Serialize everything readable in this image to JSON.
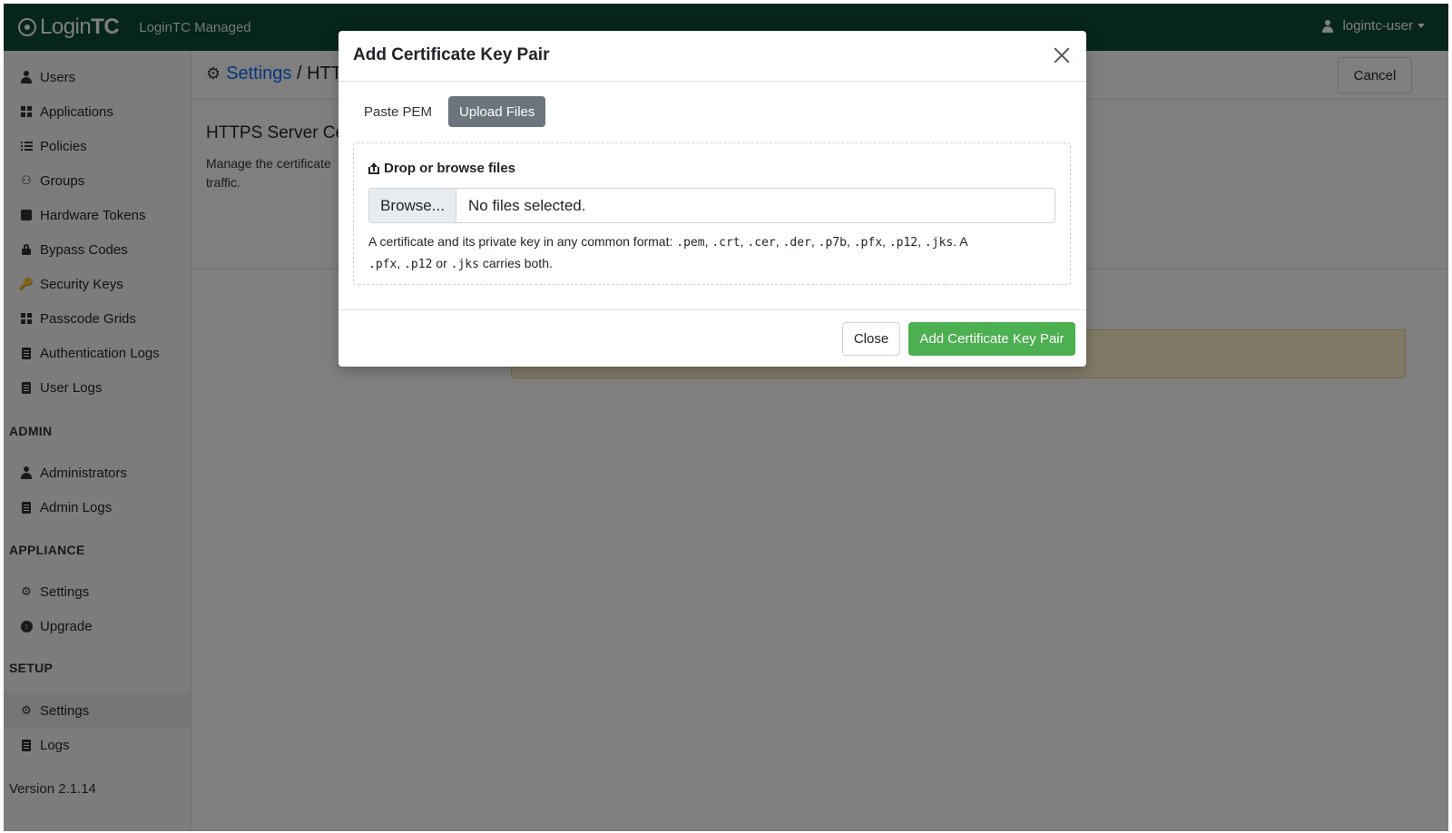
{
  "navbar": {
    "brand_login": "Login",
    "brand_tc": "TC",
    "product_name": "LoginTC Managed",
    "username": "logintc-user"
  },
  "sidebar": {
    "items": [
      {
        "label": "Users",
        "icon": "user-icon"
      },
      {
        "label": "Applications",
        "icon": "grid-icon"
      },
      {
        "label": "Policies",
        "icon": "list-icon"
      },
      {
        "label": "Groups",
        "icon": "users-icon"
      },
      {
        "label": "Hardware Tokens",
        "icon": "token-icon"
      },
      {
        "label": "Bypass Codes",
        "icon": "lock-icon"
      },
      {
        "label": "Security Keys",
        "icon": "key-icon"
      },
      {
        "label": "Passcode Grids",
        "icon": "grid-icon"
      },
      {
        "label": "Authentication Logs",
        "icon": "log-icon"
      },
      {
        "label": "User Logs",
        "icon": "log-icon"
      }
    ],
    "admin_label": "ADMIN",
    "admin_items": [
      {
        "label": "Administrators",
        "icon": "user-icon"
      },
      {
        "label": "Admin Logs",
        "icon": "log-icon"
      }
    ],
    "appliance_label": "APPLIANCE",
    "appliance_items": [
      {
        "label": "Settings",
        "icon": "gears-icon"
      },
      {
        "label": "Upgrade",
        "icon": "upgrade-icon"
      }
    ],
    "setup_label": "SETUP",
    "setup_items": [
      {
        "label": "Settings",
        "icon": "gears-icon",
        "active": true
      },
      {
        "label": "Logs",
        "icon": "log-icon"
      }
    ],
    "version": "Version 2.1.14"
  },
  "main": {
    "breadcrumb_link": "Settings",
    "breadcrumb_sep": " / ",
    "breadcrumb_current": "HTT",
    "cancel_label": "Cancel",
    "section_title": "HTTPS Server Cer",
    "section_desc": "Manage the certificate traffic."
  },
  "modal": {
    "title": "Add Certificate Key Pair",
    "tabs": [
      {
        "label": "Paste PEM",
        "active": false
      },
      {
        "label": "Upload Files",
        "active": true
      }
    ],
    "drop_label": "Drop or browse files",
    "browse_label": "Browse...",
    "file_status": "No files selected.",
    "help": {
      "prefix": "A certificate and its private key in any common format: ",
      "formats": [
        ".pem",
        ".crt",
        ".cer",
        ".der",
        ".p7b",
        ".pfx",
        ".p12",
        ".jks"
      ],
      "suffix_a": ". A ",
      "both_a": ".pfx",
      "both_b": ".p12",
      "or_word": " or ",
      "both_c": ".jks",
      "tail": " carries both."
    },
    "close_label": "Close",
    "submit_label": "Add Certificate Key Pair"
  },
  "colors": {
    "navbar": "#0b4a3a",
    "accent_green": "#4caf50",
    "tab_active": "#6c757d",
    "link": "#0d6efd"
  }
}
